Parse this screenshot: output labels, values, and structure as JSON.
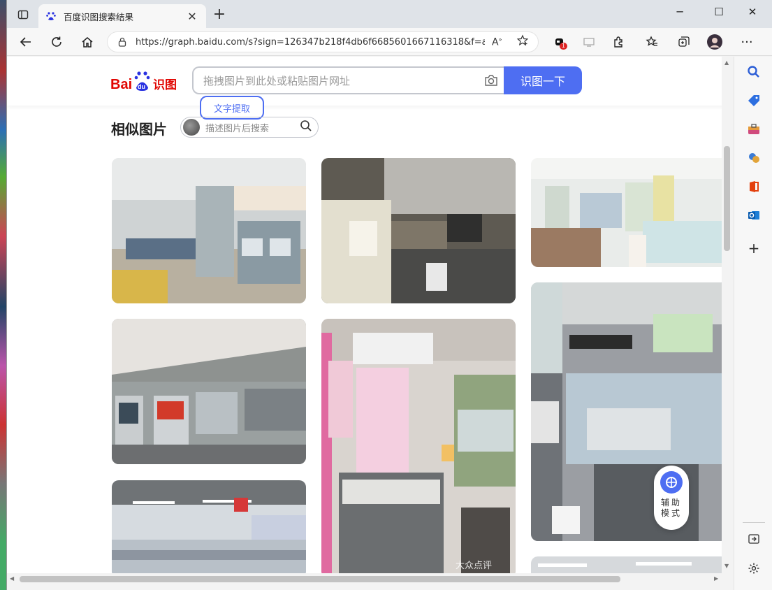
{
  "tab": {
    "title": "百度识图搜索结果"
  },
  "address_bar": {
    "url": "https://graph.baidu.com/s?sign=126347b218f4db6f6685601667116318&f=all..."
  },
  "extension_badge": "1",
  "page": {
    "logo": {
      "part1": "Bai",
      "part2": "du",
      "part3": "识图"
    },
    "search": {
      "placeholder": "拖拽图片到此处或粘贴图片网址",
      "button": "识图一下",
      "ocr_button": "文字提取"
    },
    "section_title": "相似图片",
    "desc_search_placeholder": "描述图片后搜索",
    "assist": {
      "label": "辅助模式"
    },
    "image_watermark": "大众点评"
  },
  "colors": {
    "brand_blue": "#4e6ef2",
    "baidu_red": "#e10602",
    "baidu_blue": "#2932e1"
  }
}
